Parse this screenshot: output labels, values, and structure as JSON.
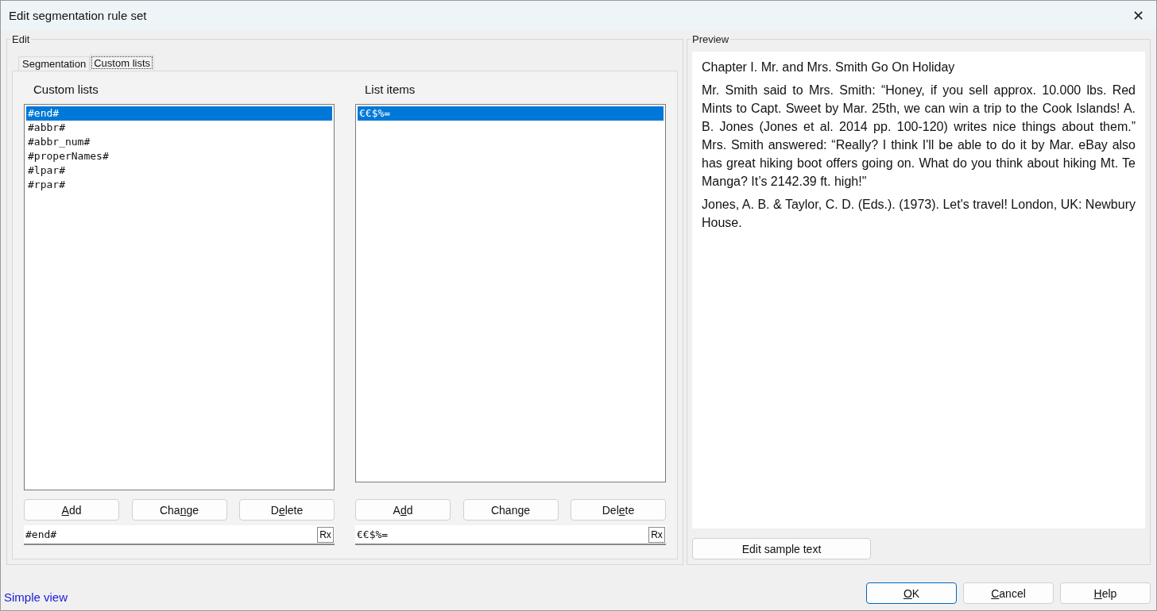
{
  "window": {
    "title": "Edit segmentation rule set",
    "close": "✕"
  },
  "edit_group": {
    "label": "Edit",
    "tabs": [
      {
        "label": "Segmentation",
        "selected": false
      },
      {
        "label": "Custom lists",
        "selected": true
      }
    ],
    "panels": [
      {
        "heading": "Custom lists",
        "items": [
          {
            "text": "#end#",
            "selected": true
          },
          {
            "text": "#abbr#",
            "selected": false
          },
          {
            "text": "#abbr_num#",
            "selected": false
          },
          {
            "text": "#properNames#",
            "selected": false
          },
          {
            "text": "#lpar#",
            "selected": false
          },
          {
            "text": "#rpar#",
            "selected": false
          }
        ],
        "buttons": [
          {
            "key": "A",
            "post": "dd"
          },
          {
            "pre": "Cha",
            "key": "n",
            "post": "ge"
          },
          {
            "pre": "D",
            "key": "e",
            "post": "lete"
          }
        ],
        "value": "#end#",
        "rx": "Rx"
      },
      {
        "heading": "List items",
        "items": [
          {
            "text": "€€$%=",
            "selected": true
          }
        ],
        "buttons": [
          {
            "pre": "A",
            "key": "d",
            "post": "d"
          },
          {
            "pre": "Change"
          },
          {
            "pre": "Del",
            "key": "e",
            "post": "te"
          }
        ],
        "value": "€€$%=",
        "rx": "Rx"
      }
    ]
  },
  "preview_group": {
    "label": "Preview",
    "paragraphs": [
      "Chapter I. Mr. and Mrs. Smith Go On Holiday",
      "Mr. Smith said to Mrs. Smith: “Honey, if you sell approx. 10.000 lbs. Red Mints to Capt. Sweet by Mar. 25th, we can win a trip to the Cook Islands! A. B. Jones (Jones et al. 2014 pp. 100-120) writes nice things about them.” Mrs. Smith answered: “Really? I think I'll be able to do it by Mar. eBay also has great hiking boot offers going on. What do you think about hiking Mt. Te Manga? It’s 2142.39 ft. high!\"",
      "Jones, A. B. & Taylor, C. D. (Eds.). (1973). Let's travel! London, UK: Newbury House."
    ],
    "button": "Edit sample text"
  },
  "footer": {
    "link": "Simple view",
    "buttons": [
      {
        "key": "O",
        "post": "K",
        "default": true
      },
      {
        "key": "C",
        "post": "ancel",
        "default": false
      },
      {
        "key": "H",
        "post": "elp",
        "default": false
      }
    ]
  }
}
